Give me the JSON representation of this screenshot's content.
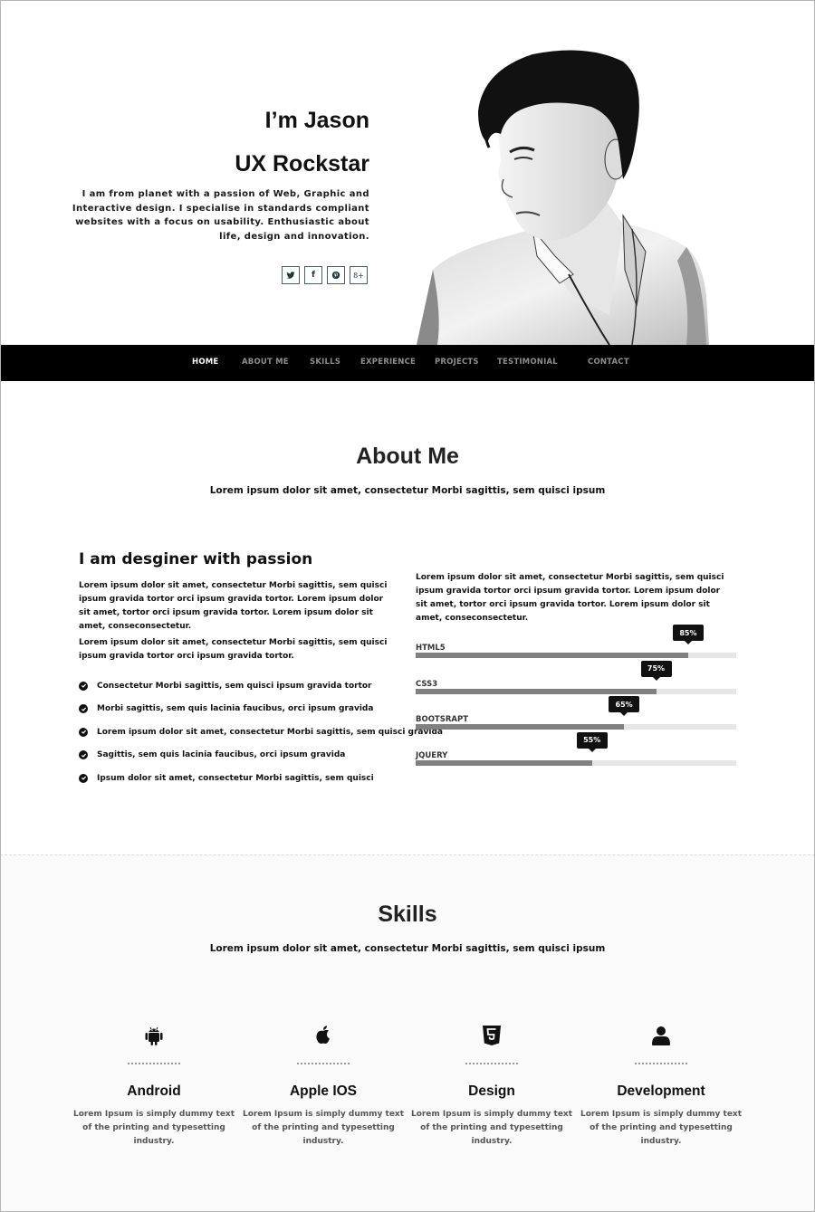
{
  "hero": {
    "greeting": "I’m Jason",
    "role": "UX Rockstar",
    "description": "I am from planet with a passion of Web, Graphic and Interactive design. I specialise in standards compliant websites with a focus on usability. Enthusiastic about life, design and innovation.",
    "social": [
      {
        "name": "twitter",
        "icon": "twitter-icon"
      },
      {
        "name": "facebook",
        "icon": "facebook-icon",
        "glyph": "f"
      },
      {
        "name": "pinterest",
        "icon": "pinterest-icon"
      },
      {
        "name": "google-plus",
        "icon": "google-plus-icon",
        "glyph": "8+"
      }
    ],
    "portrait_alt": "Black and white portrait of Jason"
  },
  "nav": {
    "items": [
      {
        "label": "HOME",
        "active": true
      },
      {
        "label": "ABOUT ME",
        "active": false
      },
      {
        "label": "SKILLS",
        "active": false
      },
      {
        "label": "EXPERIENCE",
        "active": false
      },
      {
        "label": "PROJECTS",
        "active": false
      },
      {
        "label": "TESTIMONIAL",
        "active": false
      },
      {
        "label": "CONTACT",
        "active": false
      }
    ]
  },
  "about": {
    "title": "About Me",
    "subtitle": "Lorem ipsum dolor sit amet, consectetur Morbi sagittis, sem quisci ipsum",
    "heading": "I am desginer with passion",
    "paragraph1": "Lorem ipsum dolor sit amet, consectetur Morbi sagittis, sem quisci ipsum gravida tortor orci ipsum gravida tortor. Lorem ipsum dolor sit amet, tortor orci ipsum gravida tortor. Lorem ipsum dolor sit amet, conseconsectetur.",
    "paragraph2": "Lorem ipsum dolor sit amet, consectetur Morbi sagittis, sem quisci ipsum gravida tortor orci ipsum gravida tortor.",
    "checklist": [
      "Consectetur Morbi sagittis, sem quisci ipsum gravida tortor",
      "Morbi sagittis, sem quis lacinia faucibus, orci ipsum gravida",
      "Lorem ipsum dolor sit amet, consectetur Morbi sagittis, sem quisci gravida",
      "Sagittis, sem quis lacinia faucibus, orci ipsum gravida",
      "Ipsum dolor sit amet, consectetur Morbi sagittis, sem quisci"
    ],
    "right_paragraph": "Lorem ipsum dolor sit amet, consectetur Morbi sagittis, sem quisci ipsum gravida tortor orci ipsum gravida tortor. Lorem ipsum dolor sit amet, tortor orci ipsum gravida tortor. Lorem ipsum dolor sit amet, conseconsectetur.",
    "skill_bars": [
      {
        "label": "HTML5",
        "percent": 85,
        "percent_label": "85%"
      },
      {
        "label": "CSS3",
        "percent": 75,
        "percent_label": "75%"
      },
      {
        "label": "BOOTSRAPT",
        "percent": 65,
        "percent_label": "65%"
      },
      {
        "label": "JQUERY",
        "percent": 55,
        "percent_label": "55%"
      }
    ]
  },
  "skills": {
    "title": "Skills",
    "subtitle": "Lorem ipsum dolor sit amet, consectetur Morbi sagittis, sem quisci ipsum",
    "cards": [
      {
        "name": "Android",
        "icon": "android-icon",
        "description": "Lorem Ipsum is simply dummy text of the printing and typesetting industry."
      },
      {
        "name": "Apple IOS",
        "icon": "apple-icon",
        "description": "Lorem Ipsum is simply dummy text of the printing and typesetting industry."
      },
      {
        "name": "Design",
        "icon": "html5-icon",
        "description": "Lorem Ipsum is simply dummy text of the printing and typesetting industry."
      },
      {
        "name": "Development",
        "icon": "user-icon",
        "description": "Lorem Ipsum is simply dummy text of the printing and typesetting industry."
      }
    ]
  }
}
